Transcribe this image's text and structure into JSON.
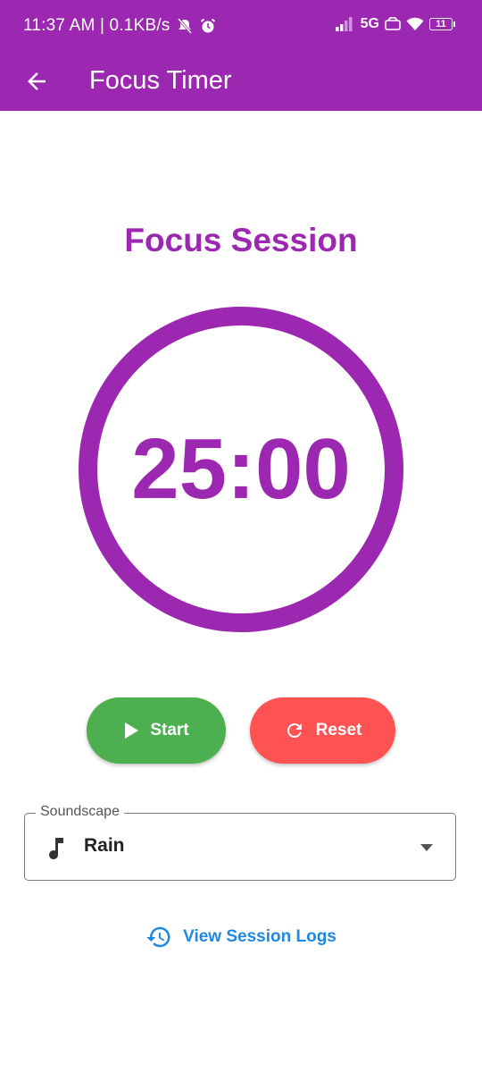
{
  "status_bar": {
    "time_speed": "11:37 AM | 0.1KB/s",
    "network": "5G",
    "battery": "11"
  },
  "app_bar": {
    "title": "Focus Timer"
  },
  "session": {
    "title": "Focus Session",
    "time": "25:00",
    "progress": 1.0
  },
  "controls": {
    "start_label": "Start",
    "reset_label": "Reset"
  },
  "soundscape": {
    "label": "Soundscape",
    "value": "Rain"
  },
  "logs_link": "View Session Logs",
  "colors": {
    "primary": "#9c27b0",
    "start": "#4caf50",
    "reset": "#ff5252",
    "link": "#1e88e5"
  }
}
